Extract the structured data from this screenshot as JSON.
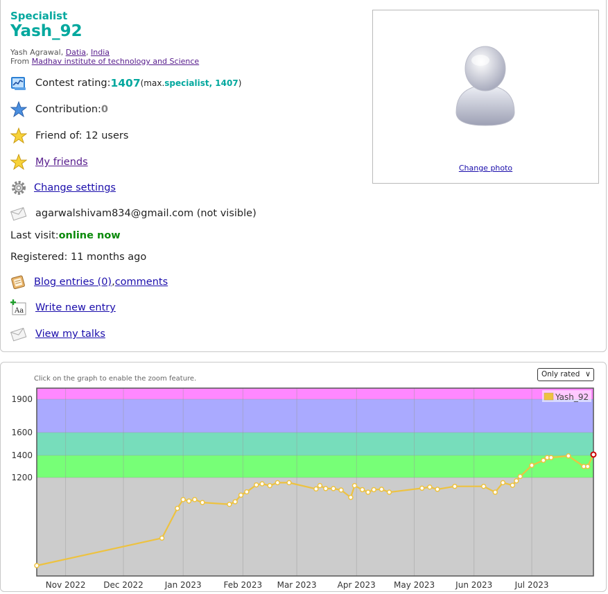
{
  "profile": {
    "rank": "Specialist",
    "handle": "Yash_92",
    "name_prefix": "Yash Agrawal, ",
    "city": "Datia",
    "country": "India",
    "from_prefix": "From ",
    "organization": "Madhav institute of technology and Science",
    "rating_label": "Contest rating: ",
    "rating_value": "1407",
    "max_prefix": " (max. ",
    "max_rank": "specialist, 1407",
    "max_suffix": ")",
    "contribution_label": "Contribution: ",
    "contribution_value": "0",
    "friend_of": "Friend of: 12 users",
    "my_friends": "My friends",
    "change_settings": "Change settings",
    "email": "agarwalshivam834@gmail.com (not visible)",
    "last_visit_label": "Last visit: ",
    "last_visit_value": "online now",
    "registered": "Registered: 11 months ago",
    "blog_entries": "Blog entries (0)",
    "comma": ", ",
    "comments": "comments",
    "write_entry": "Write new entry",
    "view_talks": "View my talks",
    "change_photo": "Change photo"
  },
  "graph": {
    "zoom_hint": "Click on the graph to enable the zoom feature.",
    "filter_selected": "Only rated"
  },
  "colors": {
    "specialist": "#03a89e",
    "online": "#0a8a0a",
    "band_newbie": "#cccccc",
    "band_pupil": "#77ff77",
    "band_specialist": "#77ddbb",
    "band_expert": "#aaaaff",
    "band_cm": "#ff88ff",
    "series": "#edc240"
  },
  "chart_data": {
    "type": "line",
    "legend": "Yash_92",
    "y_ticks": [
      1200,
      1400,
      1600,
      1900
    ],
    "x_ticks": [
      "Nov 2022",
      "Dec 2022",
      "Jan 2023",
      "Feb 2023",
      "Mar 2023",
      "Apr 2023",
      "May 2023",
      "Jun 2023",
      "Jul 2023"
    ],
    "ylim": [
      0,
      2000
    ],
    "bands": [
      {
        "from": 0,
        "to": 1200,
        "color": "#cccccc"
      },
      {
        "from": 1200,
        "to": 1400,
        "color": "#77ff77"
      },
      {
        "from": 1400,
        "to": 1600,
        "color": "#77ddbb"
      },
      {
        "from": 1600,
        "to": 1900,
        "color": "#aaaaff"
      },
      {
        "from": 1900,
        "to": 2000,
        "color": "#ff88ff"
      }
    ],
    "series": [
      {
        "name": "Yash_92",
        "points": [
          [
            "2022-10-17",
            0
          ],
          [
            "2022-12-21",
            375
          ],
          [
            "2022-12-29",
            780
          ],
          [
            "2023-01-01",
            900
          ],
          [
            "2023-01-04",
            880
          ],
          [
            "2023-01-07",
            900
          ],
          [
            "2023-01-11",
            860
          ],
          [
            "2023-01-25",
            835
          ],
          [
            "2023-01-28",
            870
          ],
          [
            "2023-01-31",
            960
          ],
          [
            "2023-02-03",
            1005
          ],
          [
            "2023-02-08",
            1100
          ],
          [
            "2023-02-11",
            1115
          ],
          [
            "2023-02-15",
            1090
          ],
          [
            "2023-02-19",
            1130
          ],
          [
            "2023-02-25",
            1130
          ],
          [
            "2023-03-11",
            1045
          ],
          [
            "2023-03-13",
            1090
          ],
          [
            "2023-03-16",
            1050
          ],
          [
            "2023-03-20",
            1050
          ],
          [
            "2023-03-24",
            1030
          ],
          [
            "2023-03-29",
            930
          ],
          [
            "2023-03-31",
            1090
          ],
          [
            "2023-04-04",
            1035
          ],
          [
            "2023-04-07",
            1000
          ],
          [
            "2023-04-10",
            1035
          ],
          [
            "2023-04-14",
            1040
          ],
          [
            "2023-04-18",
            1000
          ],
          [
            "2023-05-05",
            1055
          ],
          [
            "2023-05-09",
            1070
          ],
          [
            "2023-05-13",
            1040
          ],
          [
            "2023-05-22",
            1080
          ],
          [
            "2023-06-06",
            1080
          ],
          [
            "2023-06-12",
            1000
          ],
          [
            "2023-06-16",
            1130
          ],
          [
            "2023-06-21",
            1095
          ],
          [
            "2023-06-23",
            1155
          ],
          [
            "2023-06-25",
            1210
          ],
          [
            "2023-07-01",
            1310
          ],
          [
            "2023-07-07",
            1355
          ],
          [
            "2023-07-09",
            1380
          ],
          [
            "2023-07-11",
            1380
          ],
          [
            "2023-07-20",
            1395
          ],
          [
            "2023-07-28",
            1300
          ],
          [
            "2023-07-30",
            1300
          ],
          [
            "2023-08-02",
            1407
          ]
        ]
      }
    ]
  }
}
